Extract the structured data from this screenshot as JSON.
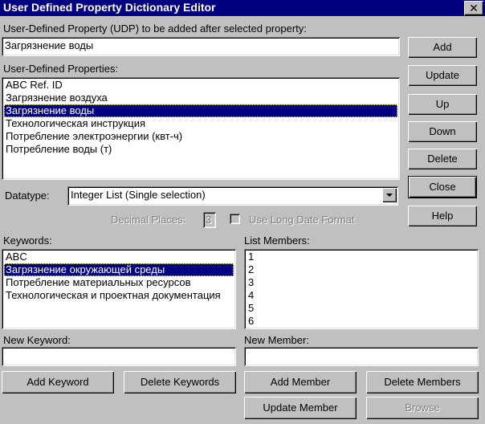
{
  "window": {
    "title": "User Defined Property Dictionary Editor",
    "close_glyph": "✕"
  },
  "udp": {
    "label": "User-Defined Property (UDP)  to be added after selected property:",
    "value": "Загрязнение воды"
  },
  "properties": {
    "label": "User-Defined Properties:",
    "items": [
      "ABC Ref. ID",
      "Загрязнение воздуха",
      "Загрязнение воды",
      "Технологическая инструкция",
      "Потребление электроэнергии (квт-ч)",
      "Потребление воды (т)"
    ],
    "selected": "Загрязнение воды"
  },
  "side_buttons": {
    "add": "Add",
    "update": "Update",
    "up": "Up",
    "down": "Down",
    "delete": "Delete",
    "close": "Close",
    "help": "Help"
  },
  "datatype": {
    "label": "Datatype:",
    "value": "Integer List (Single selection)"
  },
  "decimal": {
    "label": "Decimal Places:",
    "value": "3"
  },
  "long_date": {
    "label": "Use Long Date Format",
    "checked": false
  },
  "keywords": {
    "label": "Keywords:",
    "items": [
      "ABC",
      "Загрязнение окружающей среды",
      "Потребление материальных ресурсов",
      "Технологическая и проектная документация"
    ],
    "selected": "Загрязнение окружающей среды"
  },
  "list_members": {
    "label": "List Members:",
    "items": [
      "1",
      "2",
      "3",
      "4",
      "5",
      "6"
    ]
  },
  "new_keyword": {
    "label": "New Keyword:",
    "value": ""
  },
  "new_member": {
    "label": "New Member:",
    "value": ""
  },
  "bottom_buttons": {
    "add_keyword": "Add Keyword",
    "delete_keywords": "Delete Keywords",
    "add_member": "Add Member",
    "delete_members": "Delete Members",
    "update_member": "Update Member",
    "browse": "Browse"
  },
  "colors": {
    "titlebar": "#000080",
    "face": "#c0c0c0",
    "selection": "#000080"
  }
}
